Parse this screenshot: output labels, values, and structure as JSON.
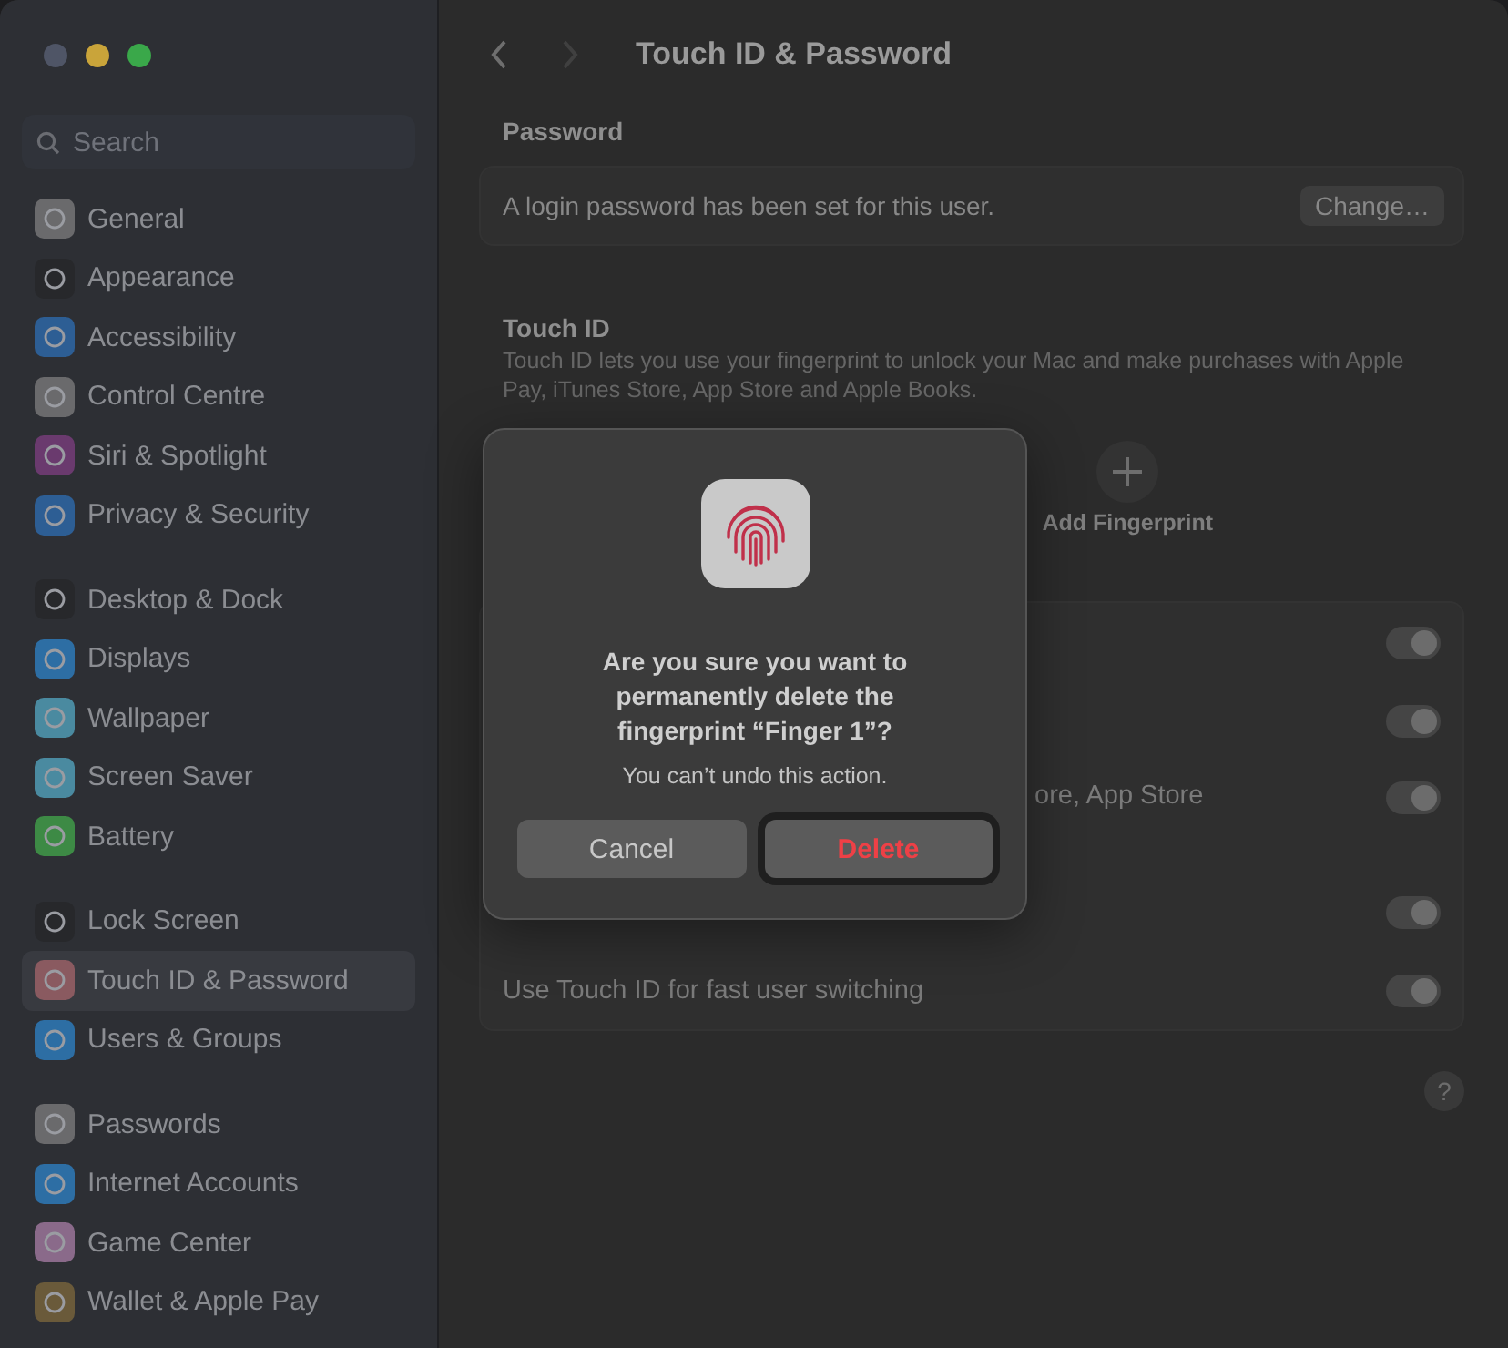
{
  "window": {
    "title": "Touch ID & Password"
  },
  "window_controls": [
    {
      "color": "#4f5566"
    },
    {
      "color": "#c9a43a"
    },
    {
      "color": "#3aa84a"
    }
  ],
  "navigation": [
    {
      "kind": "back",
      "disabled": false
    },
    {
      "kind": "forward",
      "disabled": true
    }
  ],
  "sidebar": {
    "search": {
      "placeholder": "Search"
    },
    "groups": [
      [
        {
          "label": "General",
          "color": "#6a6a6c",
          "selected": false
        },
        {
          "label": "Appearance",
          "color": "#27282b",
          "selected": false
        },
        {
          "label": "Accessibility",
          "color": "#2d5e94",
          "selected": false
        },
        {
          "label": "Control Centre",
          "color": "#6a6a6c",
          "selected": false
        },
        {
          "label": "Siri & Spotlight",
          "color": "#6a3a6e",
          "selected": false
        },
        {
          "label": "Privacy & Security",
          "color": "#2d5e94",
          "selected": false
        }
      ],
      [
        {
          "label": "Desktop & Dock",
          "color": "#27282b",
          "selected": false
        },
        {
          "label": "Displays",
          "color": "#2d6ea4",
          "selected": false
        },
        {
          "label": "Wallpaper",
          "color": "#4a8aa0",
          "selected": false
        },
        {
          "label": "Screen Saver",
          "color": "#4a8aa0",
          "selected": false
        },
        {
          "label": "Battery",
          "color": "#3d8a45",
          "selected": false
        }
      ],
      [
        {
          "label": "Lock Screen",
          "color": "#27282b",
          "selected": false
        },
        {
          "label": "Touch ID & Password",
          "color": "#8a5a60",
          "selected": true
        },
        {
          "label": "Users & Groups",
          "color": "#2d6ea4",
          "selected": false
        }
      ],
      [
        {
          "label": "Passwords",
          "color": "#6a6a6c",
          "selected": false
        },
        {
          "label": "Internet Accounts",
          "color": "#2d6ea4",
          "selected": false
        },
        {
          "label": "Game Center",
          "color": "#8a6a8a",
          "selected": false
        },
        {
          "label": "Wallet & Apple Pay",
          "color": "#6a5a3a",
          "selected": false
        }
      ]
    ]
  },
  "password_section": {
    "heading": "Password",
    "text": "A login password has been set for this user.",
    "button": "Change…"
  },
  "touch_id_section": {
    "heading": "Touch ID",
    "description": "Touch ID lets you use your fingerprint to unlock your Mac and make purchases with Apple Pay, iTunes Store, App Store and Apple Books.",
    "add_fingerprint": "Add Fingerprint",
    "options": [
      {
        "kind": "hidden",
        "on": true
      },
      {
        "kind": "hidden",
        "on": true
      },
      {
        "kind": "covered",
        "label": "ore, App Store",
        "on": true
      },
      {
        "kind": "hidden",
        "on": true
      },
      {
        "kind": "plain",
        "label": "Use Touch ID for fast user switching",
        "on": true
      }
    ]
  },
  "help": {
    "label": "?"
  },
  "dialog": {
    "title": "Are you sure you want to permanently delete the fingerprint “Finger 1”?",
    "message": "You can’t undo this action.",
    "buttons": [
      {
        "label": "Cancel",
        "kind": "cancel"
      },
      {
        "label": "Delete",
        "kind": "destructive"
      }
    ]
  }
}
